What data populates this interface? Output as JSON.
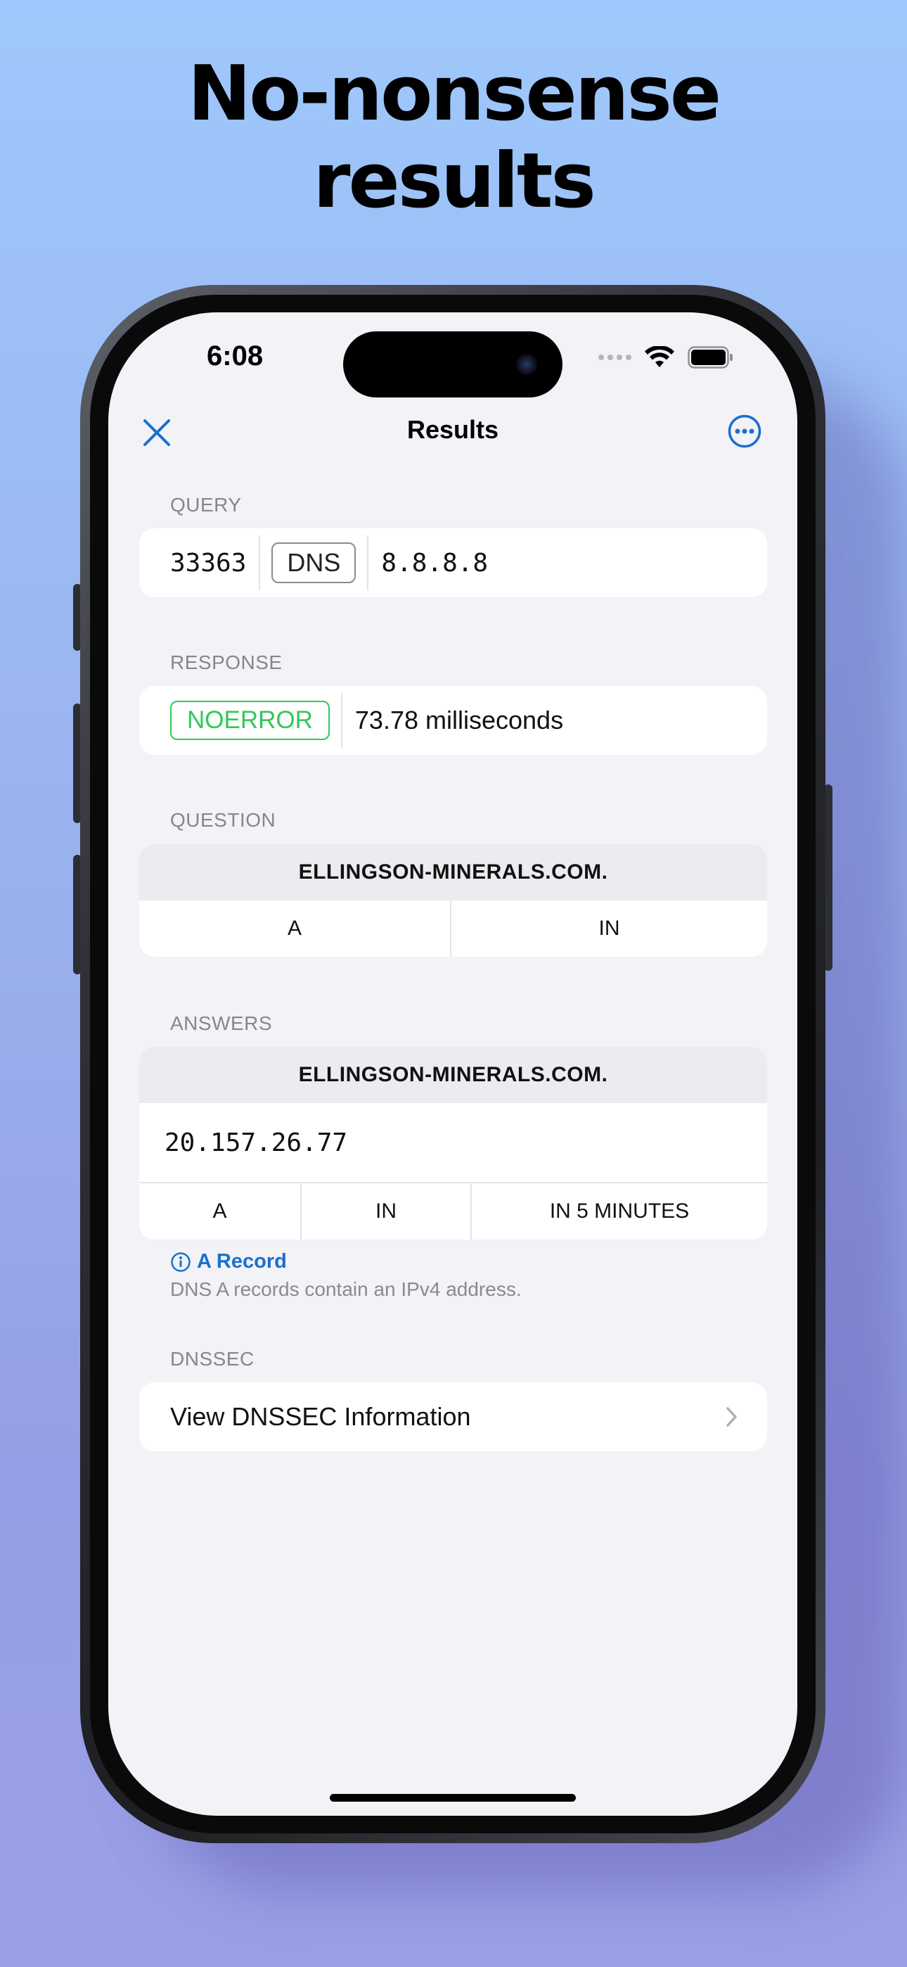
{
  "headline": {
    "line1": "No-nonsense",
    "line2": "results"
  },
  "status_bar": {
    "time": "6:08"
  },
  "nav": {
    "title": "Results",
    "close_icon": "close-icon",
    "more_icon": "ellipsis-circle-icon"
  },
  "query": {
    "label": "QUERY",
    "id": "33363",
    "protocol": "DNS",
    "server": "8.8.8.8"
  },
  "response": {
    "label": "RESPONSE",
    "status": "NOERROR",
    "time": "73.78 milliseconds",
    "status_color": "#34c759"
  },
  "question": {
    "label": "QUESTION",
    "name": "ELLINGSON-MINERALS.COM.",
    "type": "A",
    "class": "IN"
  },
  "answers": {
    "label": "ANSWERS",
    "name": "ELLINGSON-MINERALS.COM.",
    "value": "20.157.26.77",
    "type": "A",
    "class": "IN",
    "ttl": "IN 5 MINUTES",
    "info_title": "A Record",
    "info_desc": "DNS A records contain an IPv4 address."
  },
  "dnssec": {
    "label": "DNSSEC",
    "action": "View DNSSEC Information"
  },
  "colors": {
    "accent": "#1a6fd0",
    "success": "#34c759",
    "background": "#f2f2f7"
  }
}
